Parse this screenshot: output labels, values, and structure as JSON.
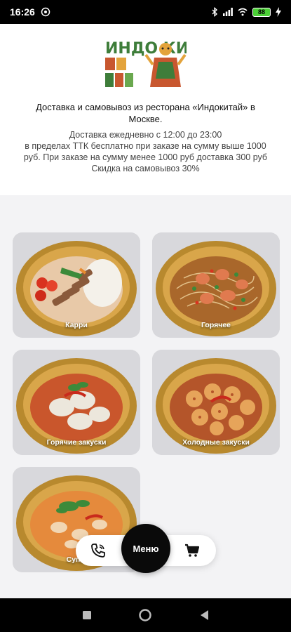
{
  "status_bar": {
    "time": "16:26",
    "battery": "88",
    "icons": [
      "whatsapp-icon",
      "bluetooth-icon",
      "signal-icon",
      "wifi-icon",
      "battery-icon",
      "charging-icon"
    ]
  },
  "header": {
    "logo_text": "ИНДО КИ ТАЙ",
    "tagline": "Доставка и самовывоз из ресторана «Индокитай» в Москве.",
    "delivery_info": [
      "Доставка ежедневно с 12:00 до 23:00",
      "в пределах ТТК бесплатно при заказе на сумму выше 1000 руб. При заказе на сумму менее 1000 руб доставка 300 руб",
      "Скидка на самовывоз 30%"
    ]
  },
  "categories": [
    {
      "label": "Карри"
    },
    {
      "label": "Горячее"
    },
    {
      "label": "Горячие закуски"
    },
    {
      "label": "Холодные закуски"
    },
    {
      "label": "Супы"
    }
  ],
  "bottom_nav": {
    "menu_label": "Меню",
    "left_icon": "phone-icon",
    "right_icon": "cart-icon"
  },
  "colors": {
    "bowl": "#c9a04a",
    "bowl_rim": "#e0c27a",
    "menu_button": "#0a0a0a"
  }
}
